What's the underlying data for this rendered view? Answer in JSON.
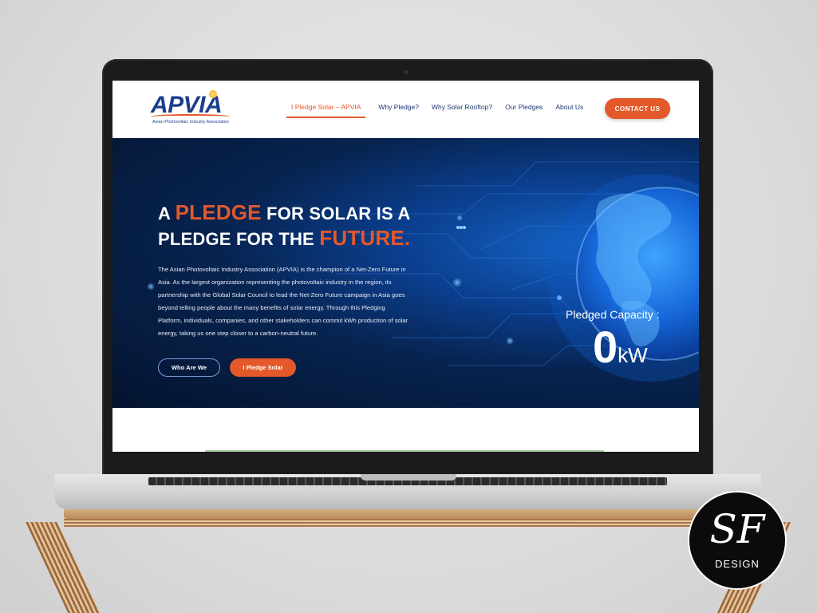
{
  "header": {
    "logo_text": "APVIA",
    "logo_subtitle": "Asian Photovoltaic Industry Association",
    "nav": [
      {
        "label": "I Pledge Solar – APVIA",
        "active": true
      },
      {
        "label": "Why Pledge?",
        "active": false
      },
      {
        "label": "Why Solar Rooftop?",
        "active": false
      },
      {
        "label": "Our Pledges",
        "active": false
      },
      {
        "label": "About Us",
        "active": false
      }
    ],
    "contact_label": "CONTACT US"
  },
  "hero": {
    "headline": {
      "w1": "A",
      "w2": "PLEDGE",
      "w3": "FOR SOLAR IS A",
      "w4": "PLEDGE FOR THE",
      "w5": "FUTURE."
    },
    "description": "The Asian Photovoltaic Industry Association (APVIA) is the champion of a Net-Zero Future in Asia. As the largest organization representing the photovoltaic industry in the region, its partnership with the Global Solar Council to lead the Net-Zero Future campaign in Asia goes beyond telling people about the many benefits of solar energy. Through this Pledging Platform, individuals, companies, and other stakeholders can commit kWh production of solar energy, taking us one step closer to a carbon-neutral future.",
    "buttons": {
      "who": "Who Are We",
      "pledge": "I Pledge Solar"
    },
    "capacity_label": "Pledged Capacity :",
    "capacity_value": "0",
    "capacity_unit": "kW"
  },
  "badge": {
    "monogram": "SF",
    "text": "DESIGN"
  },
  "colors": {
    "accent": "#e3592a",
    "brand_blue": "#1b3f8e",
    "hero_dark": "#04132e"
  }
}
